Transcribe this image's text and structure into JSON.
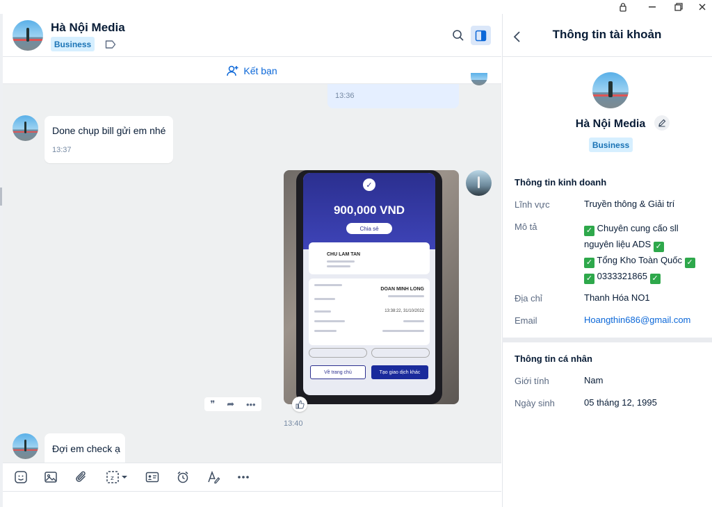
{
  "chat": {
    "contact_name": "Hà Nội Media",
    "badge": "Business",
    "add_friend_label": "Kết bạn"
  },
  "messages": [
    {
      "from": "me",
      "time": "13:36"
    },
    {
      "from": "them",
      "text": "Done chụp bill gửi em nhé",
      "time": "13:37"
    },
    {
      "from": "me",
      "type": "photo",
      "time": "13:40"
    },
    {
      "from": "them",
      "text": "Đợi em check ạ"
    }
  ],
  "receipt": {
    "amount": "900,000 VND",
    "share_label": "Chia sẻ",
    "receiver_name": "CHU LAM TAN",
    "sender_name": "DOAN MINH LONG",
    "datetime": "13:38:22, 31/10/2022",
    "home_button": "Về trang chủ",
    "new_transaction_button": "Tạo giao dịch khác"
  },
  "toolbar": {
    "icons": [
      "sticker-icon",
      "image-icon",
      "attach-icon",
      "screenshot-icon",
      "contact-card-icon",
      "reminder-icon",
      "format-text-icon",
      "more-icon"
    ]
  },
  "profile": {
    "panel_title": "Thông tin tài khoản",
    "name": "Hà Nội Media",
    "badge": "Business",
    "business_section": "Thông tin kinh doanh",
    "field_label": "Lĩnh vực",
    "field_value": "Truyền thông & Giải trí",
    "desc_label": "Mô tả",
    "desc_line1": "Chuyên cung cấo sll",
    "desc_line2": "nguyên liệu ADS",
    "desc_line3": "Tổng Kho Toàn Quốc",
    "desc_line4": "0333321865",
    "address_label": "Địa chỉ",
    "address_value": "Thanh Hóa NO1",
    "email_label": "Email",
    "email_value": "Hoangthin686@gmail.com",
    "personal_section": "Thông tin cá nhân",
    "gender_label": "Giới tính",
    "gender_value": "Nam",
    "birthday_label": "Ngày sinh",
    "birthday_value": "05 tháng 12, 1995"
  },
  "colors": {
    "accent": "#0b67d8",
    "badge_bg": "#d6efff",
    "check_green": "#2ea84b"
  }
}
